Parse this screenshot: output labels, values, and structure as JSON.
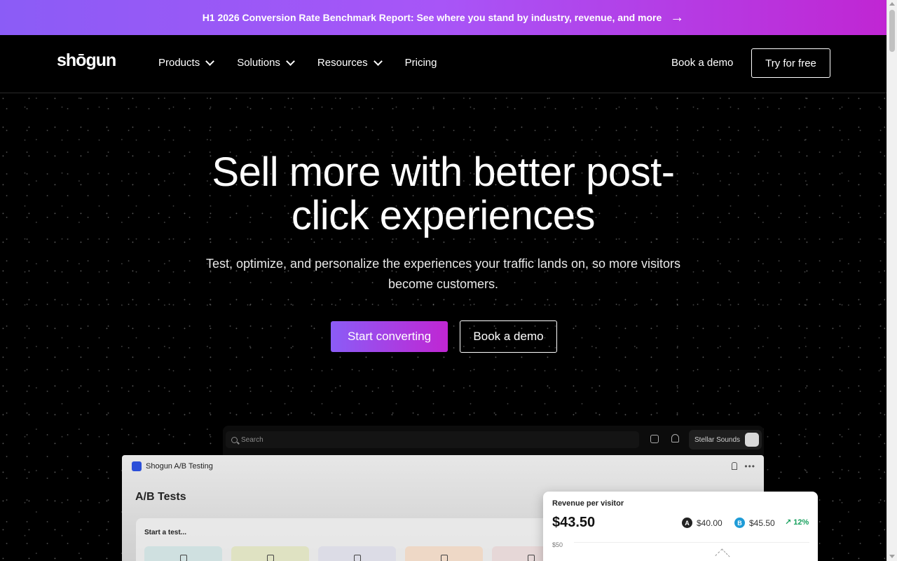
{
  "banner": {
    "text": "H1 2026 Conversion Rate Benchmark Report: See where you stand by industry, revenue, and more",
    "arrow": "→"
  },
  "nav": {
    "logo": "shōgun",
    "items": [
      {
        "label": "Products",
        "has_dropdown": true
      },
      {
        "label": "Solutions",
        "has_dropdown": true
      },
      {
        "label": "Resources",
        "has_dropdown": true
      },
      {
        "label": "Pricing",
        "has_dropdown": false
      }
    ],
    "book_demo": "Book a demo",
    "try_free": "Try for free"
  },
  "hero": {
    "title_line1": "Sell more with better post-",
    "title_line2": "click experiences",
    "subtitle_line1": "Test, optimize, and personalize the experiences your traffic lands on, so more visitors",
    "subtitle_line2": "become customers.",
    "primary_cta": "Start converting",
    "secondary_cta": "Book a demo"
  },
  "app_preview": {
    "search_placeholder": "Search",
    "store_name": "Stellar Sounds",
    "app_name": "Shogun A/B Testing",
    "section_title": "A/B Tests",
    "start_label": "Start a test...",
    "tile_colors": [
      "#cfe0e0",
      "#dfe2c2",
      "#dcdce6",
      "#eed8c6",
      "#e6d7d7"
    ],
    "revenue_card": {
      "label": "Revenue per visitor",
      "value": "$43.50",
      "variant_a_letter": "A",
      "variant_a_value": "$40.00",
      "variant_b_letter": "B",
      "variant_b_value": "$45.50",
      "lift": "↗ 12%",
      "axis_top": "$50"
    }
  },
  "colors": {
    "brand_gradient_start": "#8b5cf6",
    "brand_gradient_end": "#c026d3",
    "background": "#000000",
    "lift_green": "#17a05d",
    "variant_a": "#222222",
    "variant_b": "#1e9bd7"
  }
}
